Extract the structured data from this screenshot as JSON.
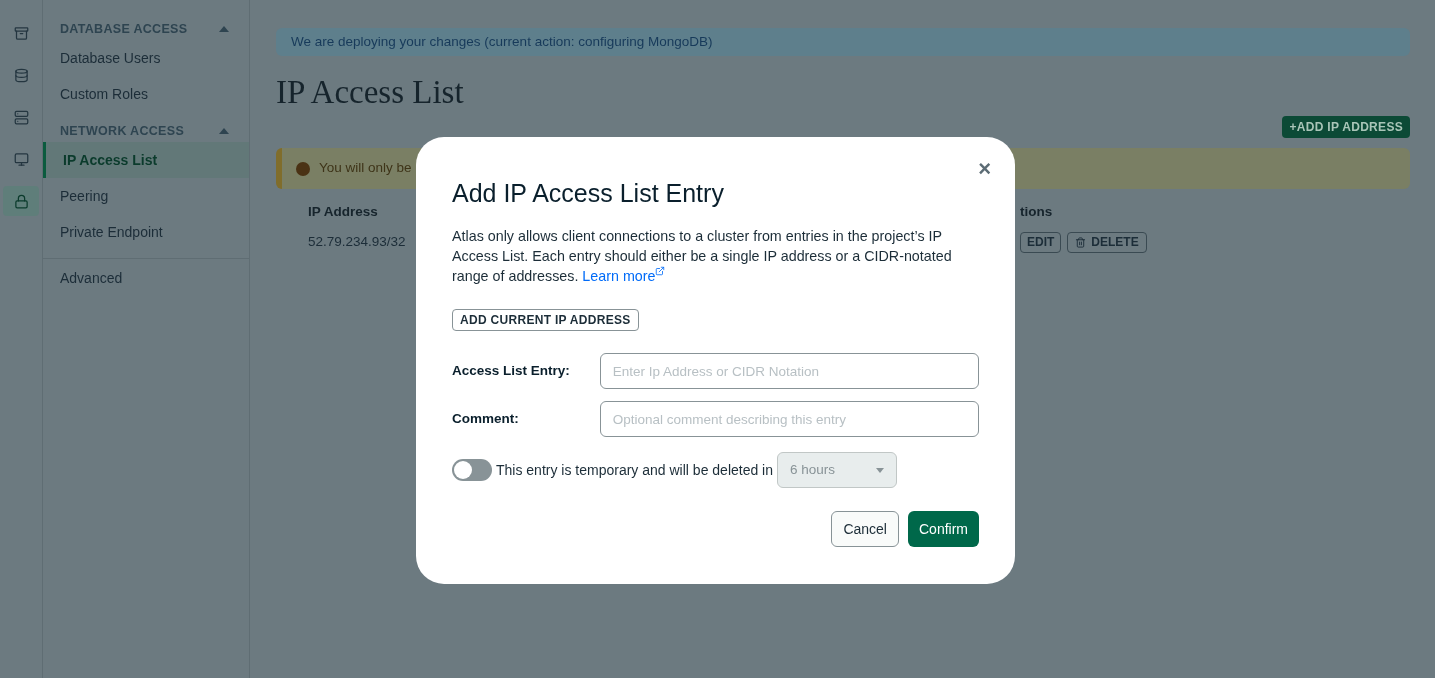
{
  "rail": [
    {
      "selected": false
    },
    {
      "selected": false
    },
    {
      "selected": false
    },
    {
      "selected": false
    },
    {
      "selected": true
    }
  ],
  "sidebar": {
    "sections": [
      {
        "title": "DATABASE ACCESS",
        "expanded": true,
        "items": [
          {
            "label": "Database Users",
            "selected": false
          },
          {
            "label": "Custom Roles",
            "selected": false
          }
        ]
      },
      {
        "title": "NETWORK ACCESS",
        "expanded": true,
        "items": [
          {
            "label": "IP Access List",
            "selected": true
          },
          {
            "label": "Peering",
            "selected": false
          },
          {
            "label": "Private Endpoint",
            "selected": false
          }
        ]
      }
    ],
    "extra_items": [
      {
        "label": "Advanced",
        "selected": false
      }
    ]
  },
  "banner": "We are deploying your changes (current action: configuring MongoDB)",
  "page_title": "IP Access List",
  "add_button": "+ADD IP ADDRESS",
  "warning": "You will only be",
  "table": {
    "columns": [
      "IP Address",
      "tions"
    ],
    "rows": [
      {
        "ip": "52.79.234.93/32",
        "edit": "EDIT",
        "delete": "DELETE"
      }
    ]
  },
  "dialog": {
    "title": "Add IP Access List Entry",
    "close": "×",
    "description": "Atlas only allows client connections to a cluster from entries in the project’s IP Access List. Each entry should either be a single IP address or a CIDR-notated range of addresses.",
    "link": "Learn more",
    "add_current": "ADD CURRENT IP ADDRESS",
    "fields": [
      {
        "label": "Access List Entry:",
        "placeholder": "Enter Ip Address or CIDR Notation"
      },
      {
        "label": "Comment:",
        "placeholder": "Optional comment describing this entry"
      }
    ],
    "temporary": {
      "on": false,
      "label": "This entry is temporary and will be deleted in",
      "duration": "6 hours",
      "disabled": true
    },
    "cancel": "Cancel",
    "confirm": "Confirm"
  }
}
